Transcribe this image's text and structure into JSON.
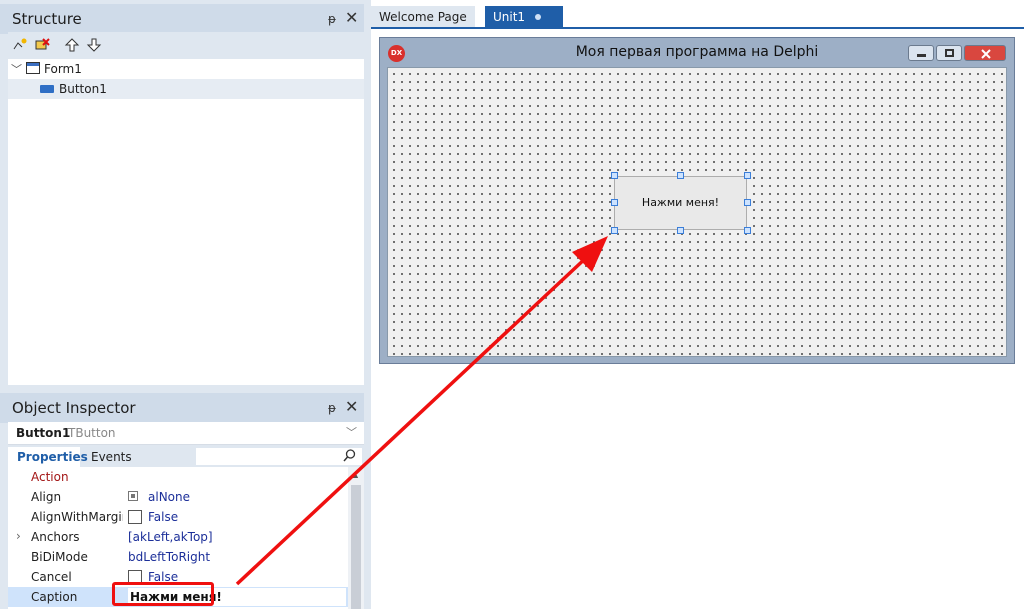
{
  "structure": {
    "title": "Structure",
    "pin_glyph": "ᵽ",
    "close_glyph": "✕",
    "toolbar": [
      "new-item-icon",
      "delete-item-icon",
      "move-up-icon",
      "move-down-icon"
    ],
    "tree": [
      {
        "label": "Form1",
        "icon": "form-icon",
        "expanded": true
      },
      {
        "label": "Button1",
        "icon": "button-component-icon",
        "selected": true
      }
    ]
  },
  "inspector": {
    "title": "Object Inspector",
    "pin_glyph": "ᵽ",
    "close_glyph": "✕",
    "selected_name": "Button1",
    "selected_type": "TButton",
    "tabs": [
      "Properties",
      "Events"
    ],
    "active_tab": "Properties",
    "properties": [
      {
        "name": "Action",
        "value": ""
      },
      {
        "name": "Align",
        "value": "alNone"
      },
      {
        "name": "AlignWithMargins",
        "value": "False"
      },
      {
        "name": "Anchors",
        "value": "[akLeft,akTop]"
      },
      {
        "name": "BiDiMode",
        "value": "bdLeftToRight"
      },
      {
        "name": "Cancel",
        "value": "False"
      },
      {
        "name": "Caption",
        "value": "Нажми меня!"
      }
    ]
  },
  "designer": {
    "tabs": [
      "Welcome Page",
      "Unit1"
    ],
    "active_tab": "Unit1",
    "form_title": "Моя первая программа на Delphi",
    "form_icon_text": "DX",
    "button_caption": "Нажми меня!"
  },
  "colors": {
    "panel_header": "#cfdbe9",
    "accent": "#1f5ea8",
    "property_name_red": "#a31515",
    "property_value": "#1c2f99",
    "annotation": "#ef1010"
  }
}
